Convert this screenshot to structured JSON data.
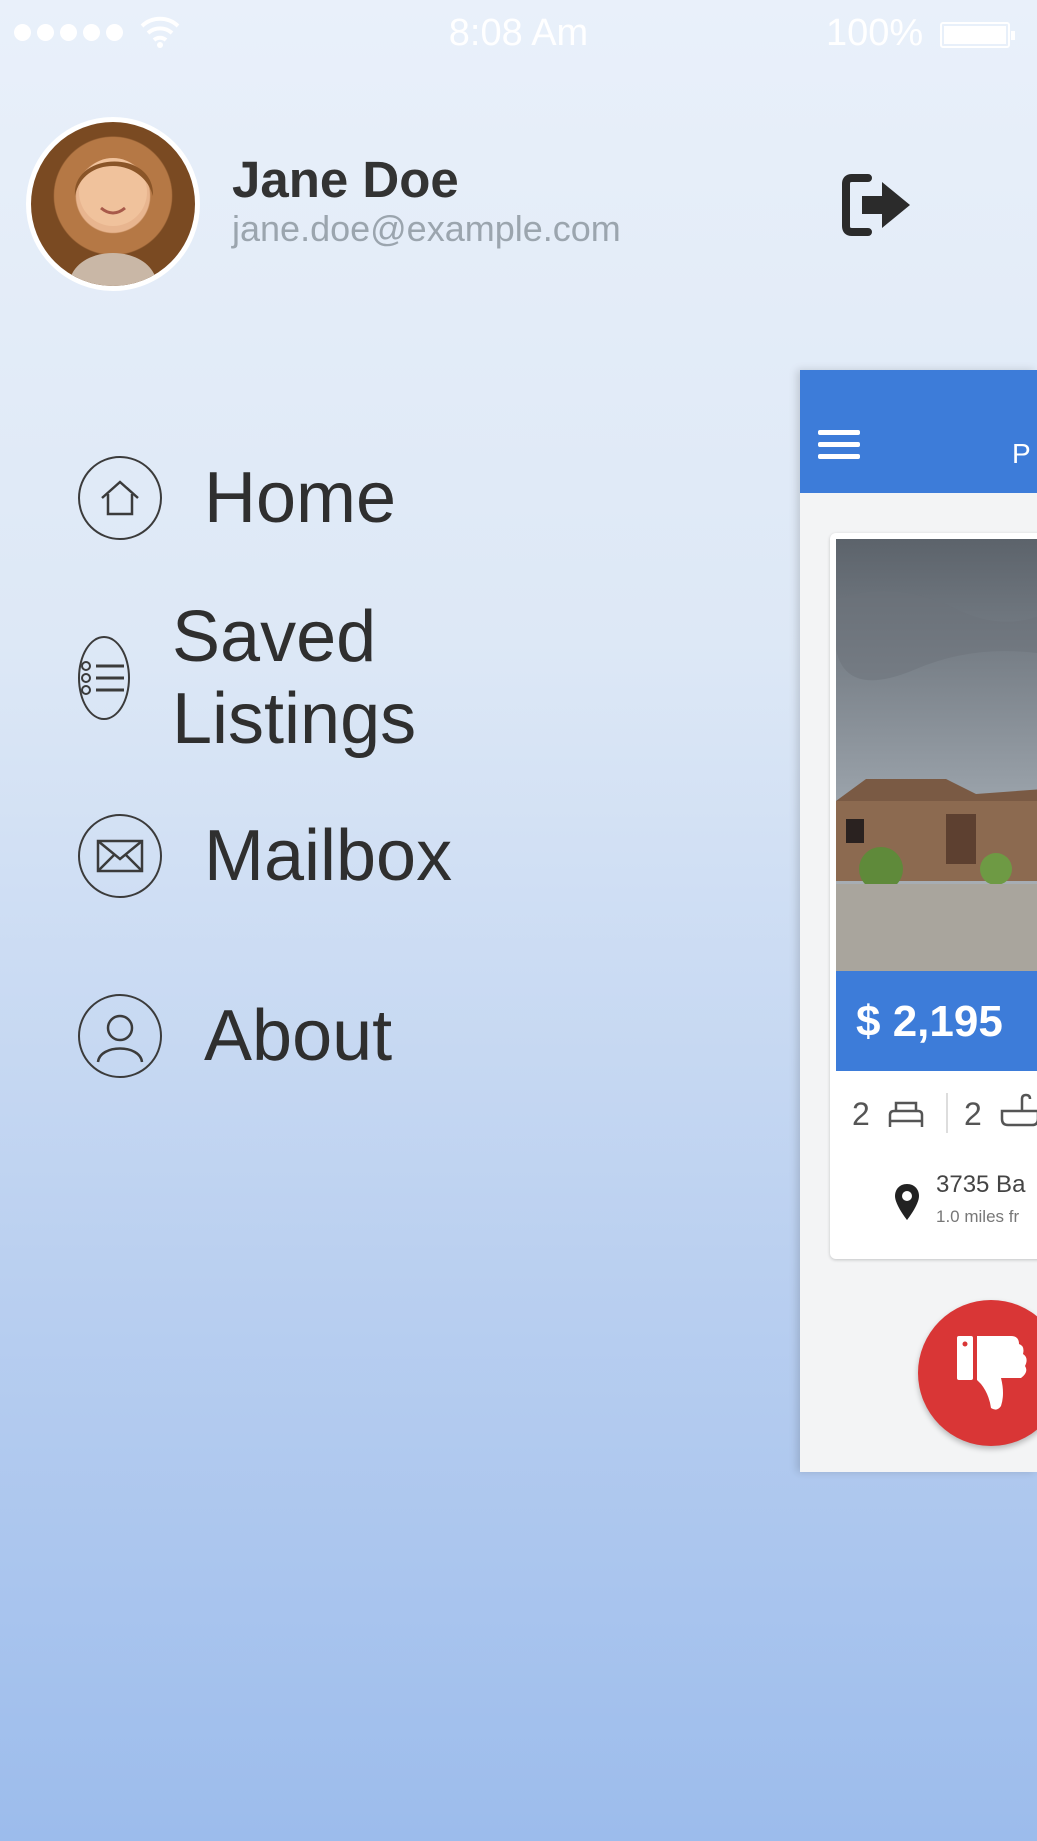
{
  "status_bar": {
    "time": "8:08 Am",
    "battery_percent": "100%"
  },
  "profile": {
    "name": "Jane Doe",
    "email": "jane.doe@example.com"
  },
  "menu": {
    "items": [
      {
        "label": "Home",
        "icon": "home-icon"
      },
      {
        "label": "Saved Listings",
        "icon": "list-icon"
      },
      {
        "label": "Mailbox",
        "icon": "mail-icon"
      },
      {
        "label": "About",
        "icon": "user-icon"
      }
    ]
  },
  "app_peek": {
    "header_title": "P",
    "listing": {
      "price": "$ 2,195",
      "beds": "2",
      "baths": "2",
      "address": "3735 Ba",
      "distance": "1.0 miles fr"
    }
  },
  "colors": {
    "accent": "#3d7cd9",
    "dislike": "#d93636",
    "text": "#2f2f2f"
  }
}
